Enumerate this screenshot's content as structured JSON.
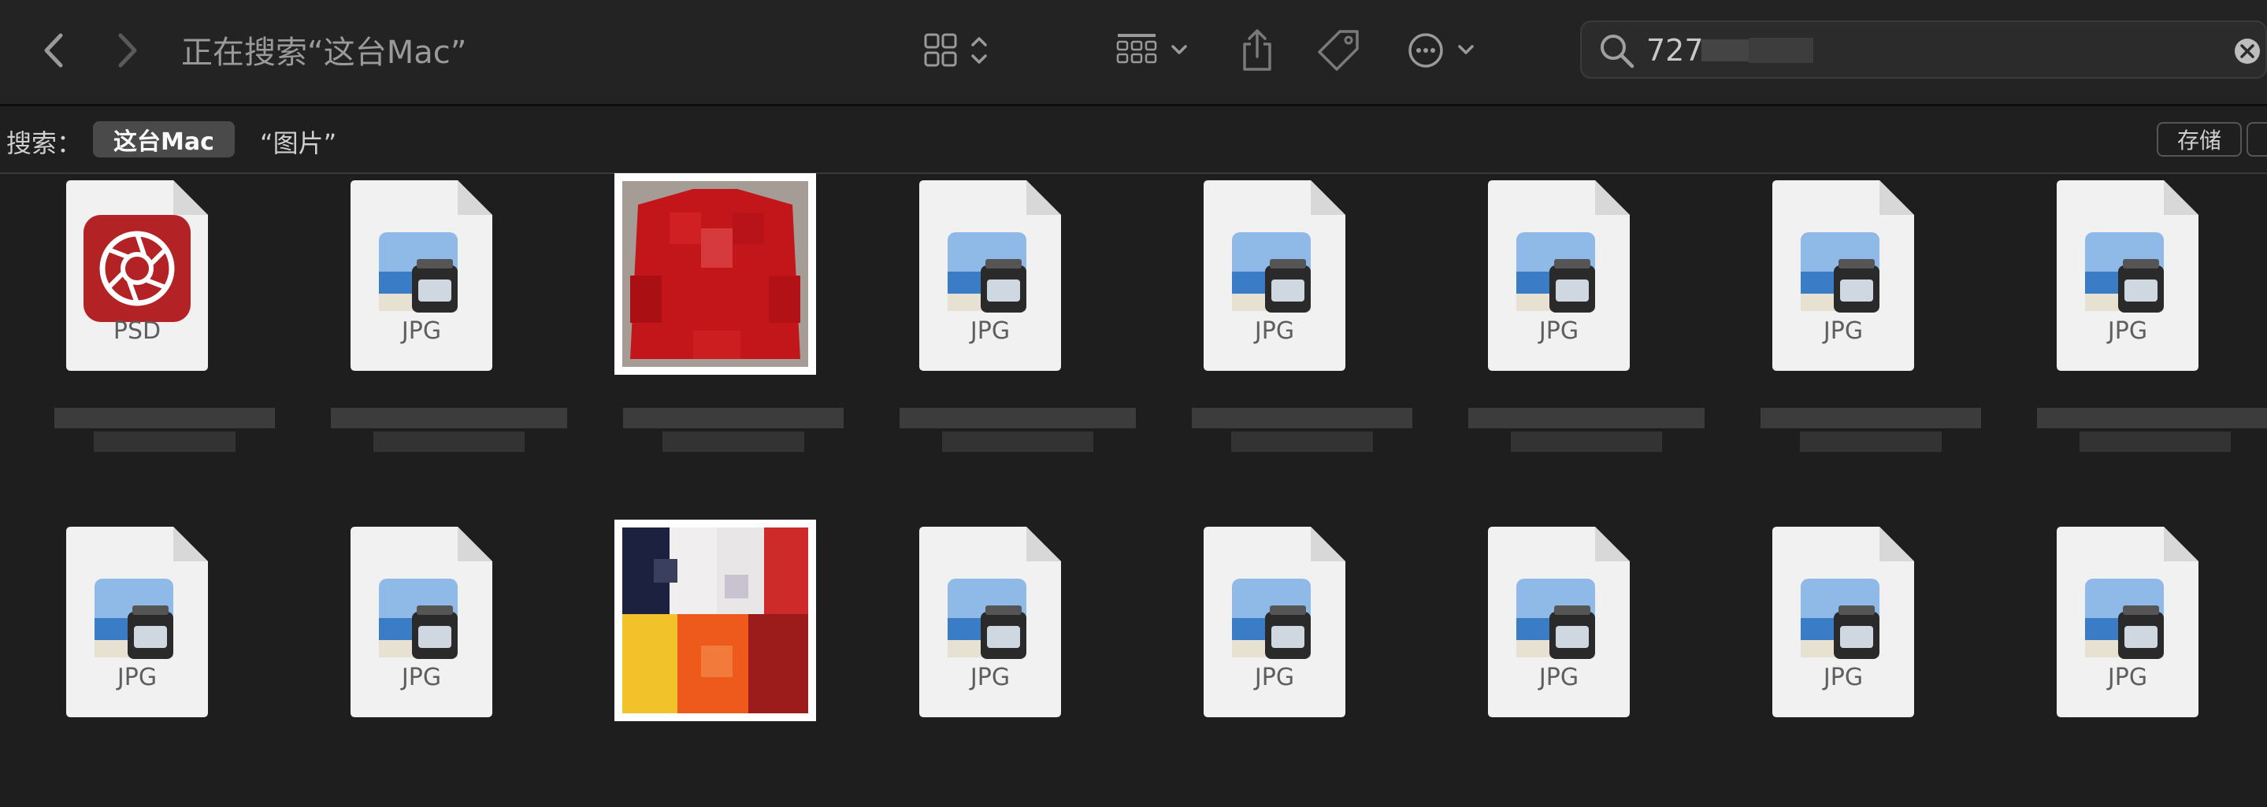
{
  "window": {
    "title": "正在搜索“这台Mac”"
  },
  "search": {
    "query": "727"
  },
  "scope": {
    "label": "搜索：",
    "active": "这台Mac",
    "other": "“图片”",
    "save": "存储"
  },
  "icons": {
    "back": "chevron-left-icon",
    "forward": "chevron-right-icon",
    "view": "grid-view-icon",
    "group": "group-by-icon",
    "share": "share-icon",
    "tag": "tag-icon",
    "more": "ellipsis-circle-icon",
    "search": "magnifier-icon",
    "clear": "clear-circle-icon"
  },
  "files": [
    {
      "type": "PSD"
    },
    {
      "type": "JPG"
    },
    {
      "type": "photo-red-jacket"
    },
    {
      "type": "JPG"
    },
    {
      "type": "JPG"
    },
    {
      "type": "JPG"
    },
    {
      "type": "JPG"
    },
    {
      "type": "JPG"
    },
    {
      "type": "JPG"
    },
    {
      "type": "JPG"
    },
    {
      "type": "photo-jerseys"
    },
    {
      "type": "JPG"
    },
    {
      "type": "JPG"
    },
    {
      "type": "JPG"
    },
    {
      "type": "JPG"
    },
    {
      "type": "JPG"
    }
  ],
  "labels": {
    "psd": "PSD",
    "jpg": "JPG"
  },
  "colors": {
    "background": "#1e1e1e",
    "toolbar": "#232323",
    "psd_accent": "#c8282a",
    "chip": "#4a4a4a"
  }
}
